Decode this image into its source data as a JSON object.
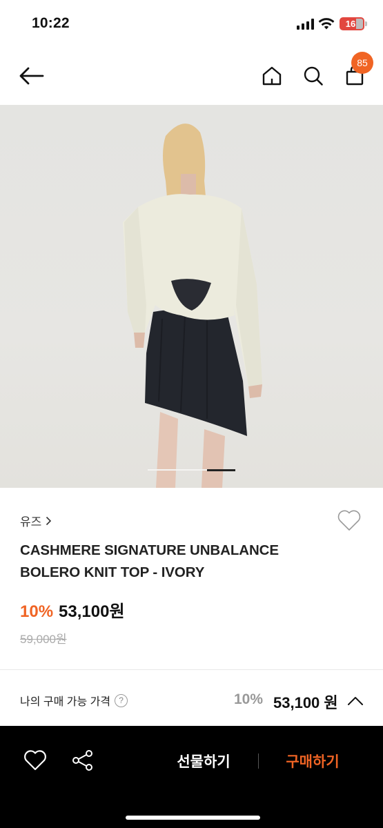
{
  "status_bar": {
    "time": "10:22",
    "battery": "16"
  },
  "header": {
    "cart_badge": "85"
  },
  "product": {
    "brand": "유즈",
    "title_line1": "CASHMERE SIGNATURE UNBALANCE",
    "title_line2": "BOLERO KNIT TOP - IVORY",
    "discount": "10%",
    "sale_price": "53,100원",
    "original_price": "59,000원",
    "image_pager": {
      "total": 3,
      "active": 3
    }
  },
  "my_price": {
    "label": "나의 구매 가능 가격",
    "help": "?",
    "discount": "10%",
    "price": "53,100 원"
  },
  "bottom_bar": {
    "gift_label": "선물하기",
    "buy_label": "구매하기"
  },
  "colors": {
    "accent": "#f06424",
    "bottom_bar": "#000000"
  }
}
